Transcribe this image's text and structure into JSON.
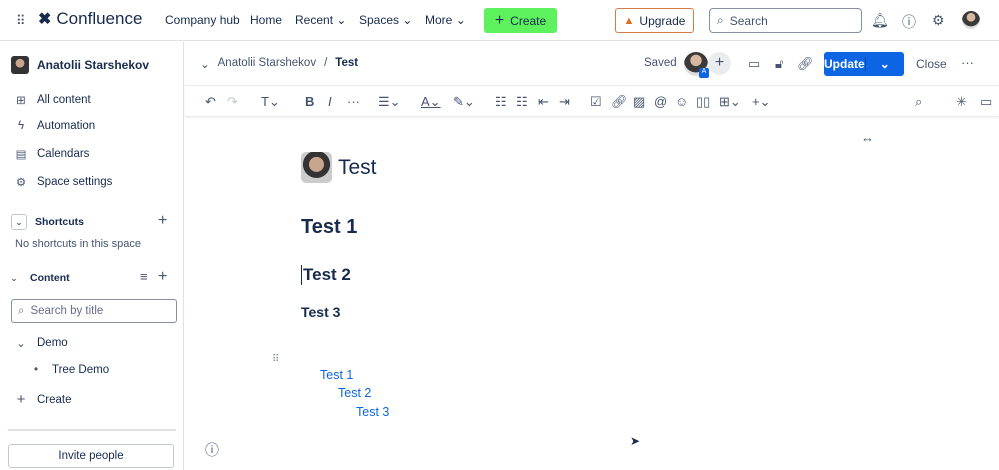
{
  "topnav": {
    "brand": "Confluence",
    "items": [
      "Company hub",
      "Home",
      "Recent",
      "Spaces",
      "More"
    ],
    "create": "Create",
    "upgrade": "Upgrade",
    "search_placeholder": "Search"
  },
  "sidebar": {
    "space_name": "Anatolii Starshekov",
    "items": [
      "All content",
      "Automation",
      "Calendars",
      "Space settings"
    ],
    "shortcuts_label": "Shortcuts",
    "no_shortcuts": "No shortcuts in this space",
    "content_label": "Content",
    "search_placeholder": "Search by title",
    "tree": [
      "Demo",
      "Tree Demo"
    ],
    "create": "Create",
    "invite": "Invite people"
  },
  "header": {
    "breadcrumb_parent": "Anatolii Starshekov",
    "breadcrumb_sep": "/",
    "breadcrumb_current": "Test",
    "saved": "Saved",
    "avatar_badge": "A",
    "update": "Update",
    "close": "Close"
  },
  "page": {
    "title": "Test",
    "headings": [
      "Test 1",
      "Test 2",
      "Test 3"
    ],
    "toc": [
      "Test 1",
      "Test 2",
      "Test 3"
    ]
  },
  "colors": {
    "primary": "#0c66e4",
    "create": "#5ef15e"
  }
}
